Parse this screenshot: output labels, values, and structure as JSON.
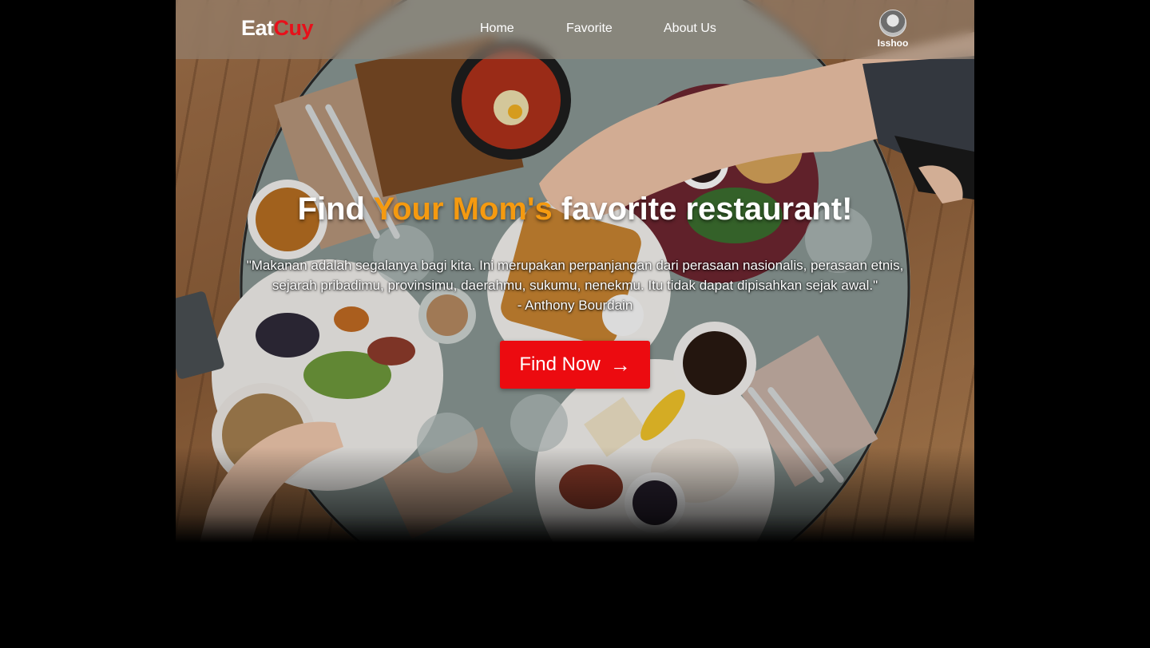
{
  "brand": {
    "part1": "Eat",
    "part2": "Cuy",
    "color_part2": "#e8101a"
  },
  "nav": {
    "links": [
      "Home",
      "Favorite",
      "About Us"
    ]
  },
  "profile": {
    "username": "Isshoo",
    "icon": "user-avatar-icon"
  },
  "hero": {
    "headline_start": "Find ",
    "headline_accent": "Your Mom's",
    "headline_end": " favorite restaurant!",
    "accent_color": "#f59a10",
    "quote": "\"Makanan adalah segalanya bagi kita. Ini merupakan perpanjangan dari perasaan nasionalis, perasaan etnis, sejarah pribadimu, provinsimu, daerahmu, sukumu, nenekmu. Itu tidak dapat dipisahkan sejak awal.\"",
    "quote_author": "- Anthony Bourdain",
    "cta_label": "Find Now",
    "cta_icon": "arrow-right-icon",
    "cta_color": "#ec0b10"
  }
}
